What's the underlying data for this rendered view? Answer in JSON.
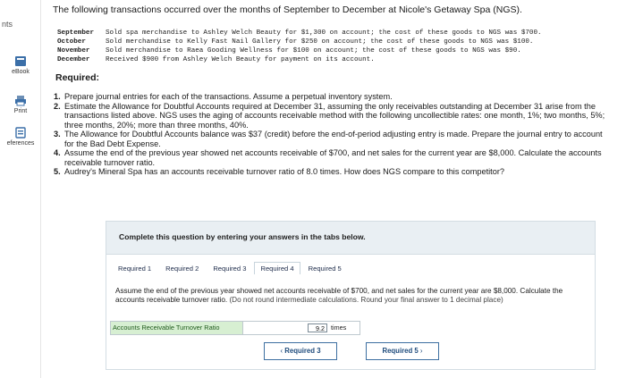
{
  "sidebar": {
    "top_label": "nts",
    "items": [
      {
        "label": "eBook",
        "icon": "ebook-icon"
      },
      {
        "label": "Print",
        "icon": "print-icon"
      },
      {
        "label": "eferences",
        "icon": "references-icon"
      }
    ]
  },
  "intro": "The following transactions occurred over the months of September to December at Nicole's Getaway Spa (NGS).",
  "transactions": [
    {
      "month": "September",
      "desc": "Sold spa merchandise to Ashley Welch Beauty for $1,300 on account; the cost of these goods to NGS was $700."
    },
    {
      "month": "October",
      "desc": "Sold merchandise to Kelly Fast Nail Gallery for $250 on account; the cost of these goods to NGS was $100."
    },
    {
      "month": "November",
      "desc": "Sold merchandise to Raea Gooding Wellness for $100 on account; the cost of these goods to NGS was $90."
    },
    {
      "month": "December",
      "desc": "Received $900 from Ashley Welch Beauty for payment on its account."
    }
  ],
  "required_heading": "Required:",
  "requirements": [
    {
      "num": "1.",
      "text": "Prepare journal entries for each of the transactions. Assume a perpetual inventory system."
    },
    {
      "num": "2.",
      "text": "Estimate the Allowance for Doubtful Accounts required at December 31, assuming the only receivables outstanding at December 31 arise from the transactions listed above. NGS uses the aging of accounts receivable method with the following uncollectible rates: one month, 1%; two months, 5%; three months, 20%; more than three months, 40%."
    },
    {
      "num": "3.",
      "text": "The Allowance for Doubtful Accounts balance was $37 (credit) before the end-of-period adjusting entry is made. Prepare the journal entry to account for the Bad Debt Expense."
    },
    {
      "num": "4.",
      "text": "Assume the end of the previous year showed net accounts receivable of $700, and net sales for the current year are $8,000. Calculate the accounts receivable turnover ratio."
    },
    {
      "num": "5.",
      "text": "Audrey's Mineral Spa has an accounts receivable turnover ratio of 8.0 times. How does NGS compare to this competitor?"
    }
  ],
  "panel_label": "Complete this question by entering your answers in the tabs below.",
  "tabs": [
    {
      "label": "Required 1",
      "active": false
    },
    {
      "label": "Required 2",
      "active": false
    },
    {
      "label": "Required 3",
      "active": false
    },
    {
      "label": "Required 4",
      "active": true
    },
    {
      "label": "Required 5",
      "active": false
    }
  ],
  "instruction": "Assume the end of the previous year showed net accounts receivable of $700, and net sales for the current year are $8,000. Calculate the accounts receivable turnover ratio.",
  "instruction_hint": "(Do not round intermediate calculations. Round your final answer to 1 decimal place)",
  "answer": {
    "label": "Accounts Receivable Turnover Ratio",
    "value": "9.2",
    "unit": "times"
  },
  "nav": {
    "prev_label": "Required 3",
    "next_label": "Required 5",
    "prev_chevron": "‹",
    "next_chevron": "›"
  },
  "colors": {
    "accent": "#1e4b7c",
    "answer_label_bg": "#d7efd2",
    "panel_bg": "#e9eff3"
  }
}
